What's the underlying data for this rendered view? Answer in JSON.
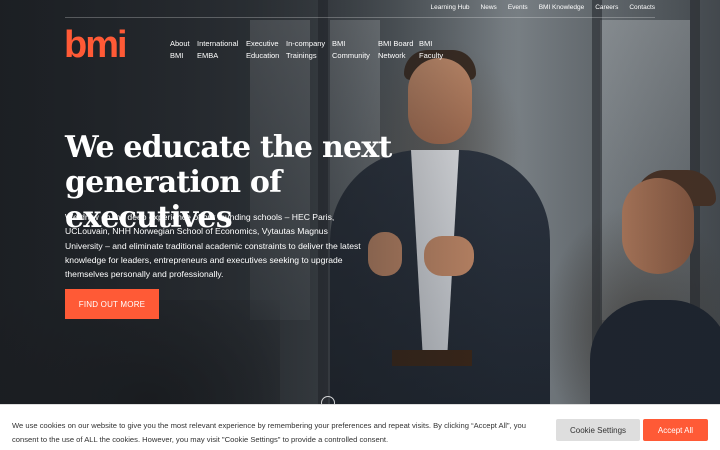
{
  "brand": {
    "logo_text": "bmi",
    "accent_color": "#ff5a36"
  },
  "top_links": [
    "Learning Hub",
    "News",
    "Events",
    "BMI Knowledge",
    "Careers",
    "Contacts"
  ],
  "main_nav": [
    "About\nBMI",
    "International\nEMBA",
    "Executive\nEducation",
    "In-company\nTrainings",
    "BMI\nCommunity",
    "BMI Board\nNetwork",
    "BMI\nFaculty"
  ],
  "hero": {
    "headline": "We educate the next generation of executives",
    "subtext": "We draw on the deep experience of our founding schools – HEC Paris, UCLouvain, NHH Norwegian School of Economics, Vytautas Magnus University – and eliminate traditional academic constraints to deliver the latest knowledge for leaders, entrepreneurs and executives seeking to upgrade themselves personally and professionally.",
    "cta_label": "FIND OUT MORE"
  },
  "cookie_banner": {
    "text": "We use cookies on our website to give you the most relevant experience by remembering your preferences and repeat visits. By clicking “Accept All”, you consent to the use of ALL the cookies. However, you may visit \"Cookie Settings\" to provide a controlled consent.",
    "settings_label": "Cookie Settings",
    "accept_label": "Accept All"
  }
}
